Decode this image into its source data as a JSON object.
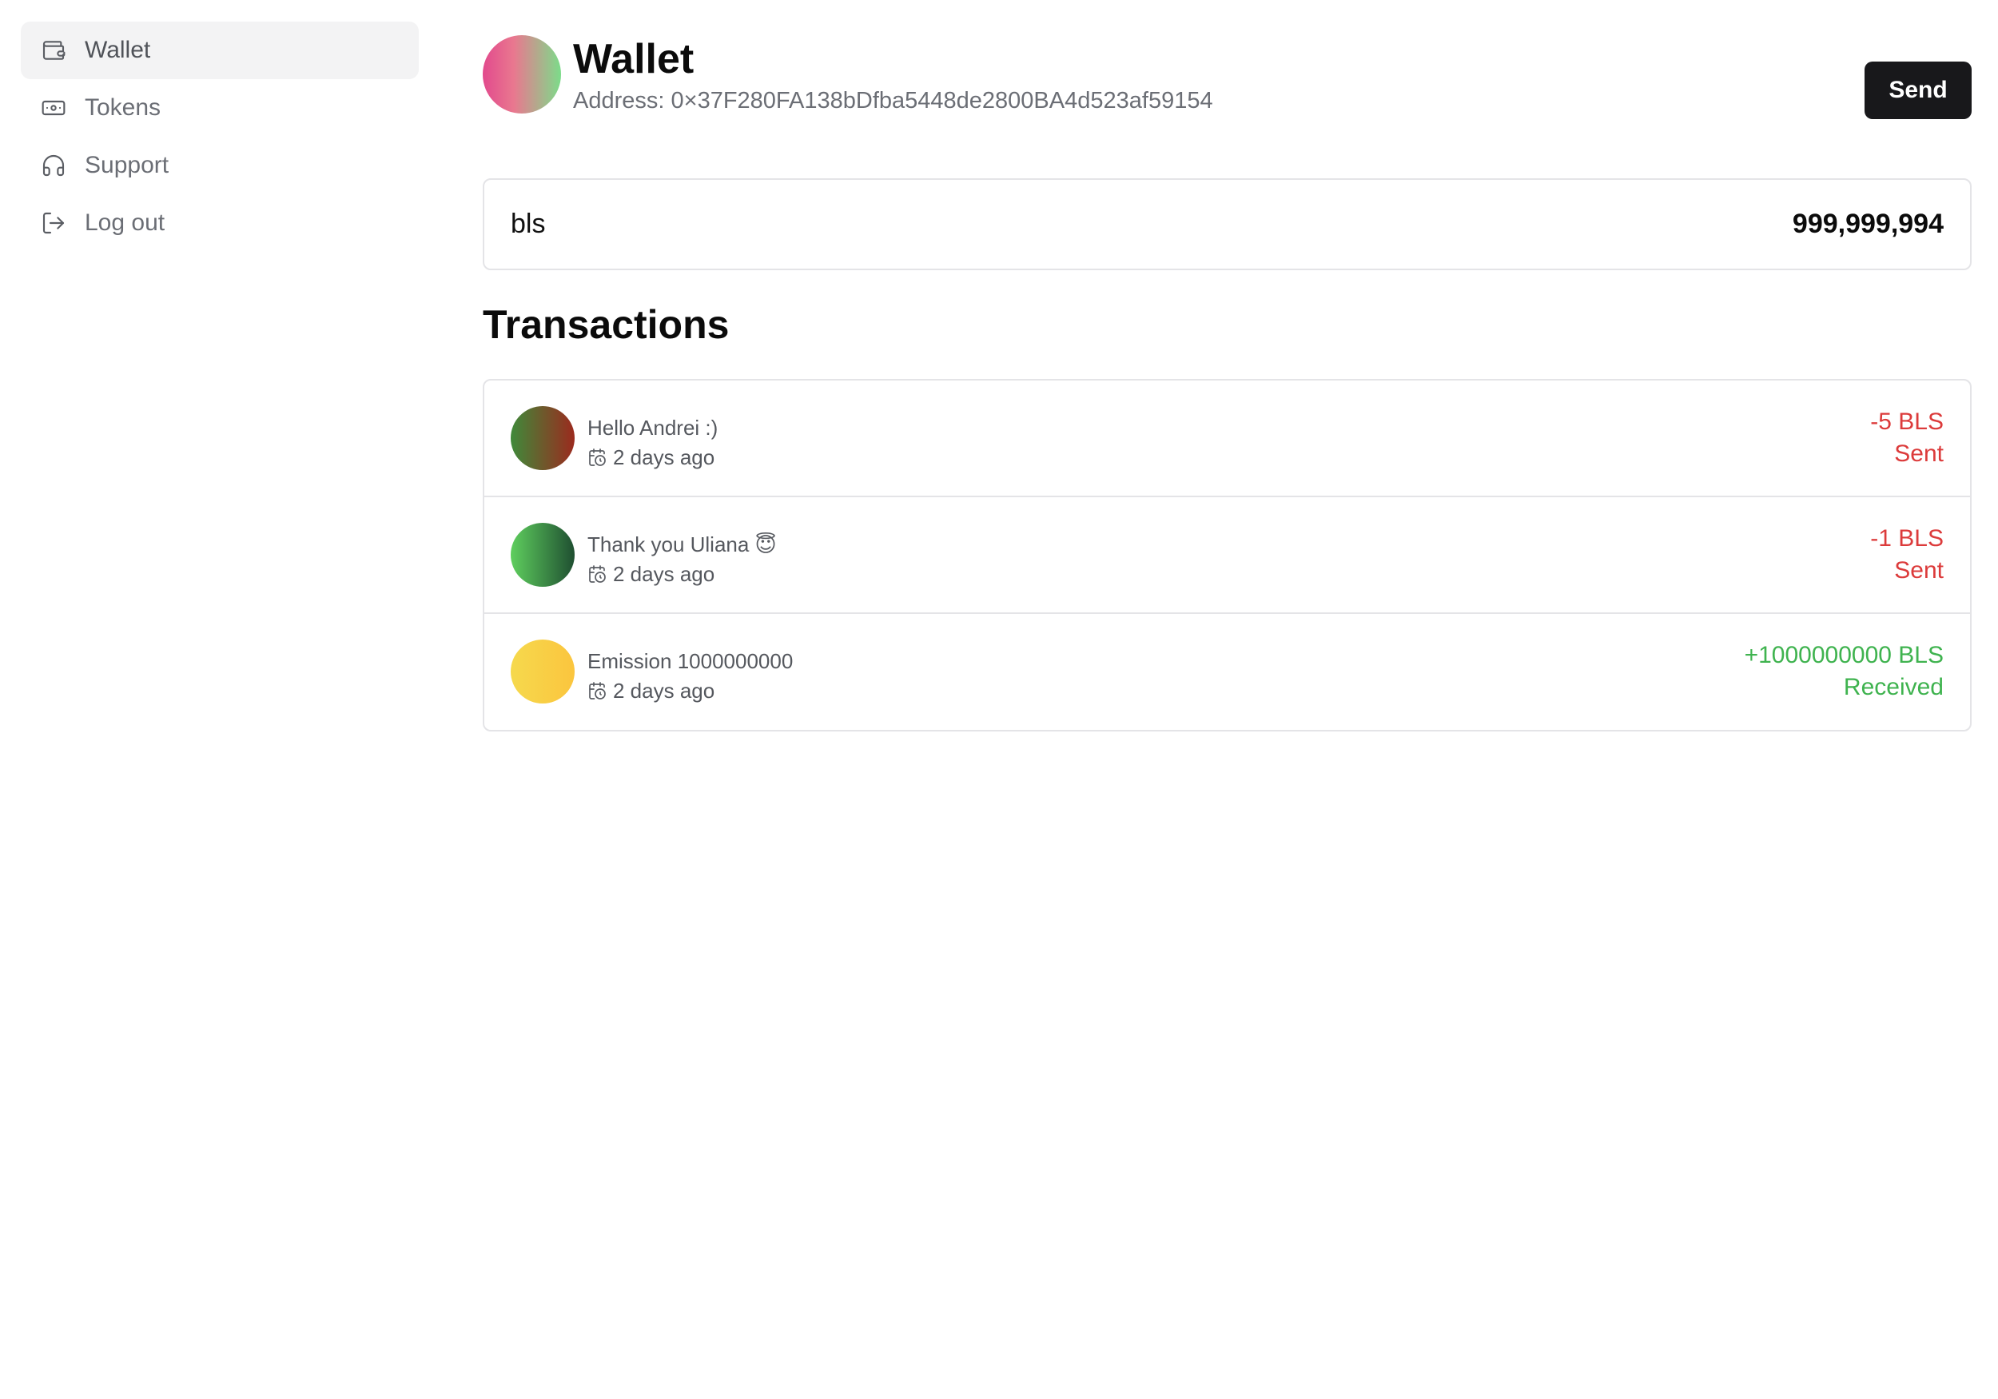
{
  "sidebar": {
    "items": [
      {
        "label": "Wallet",
        "icon": "wallet-icon",
        "active": true
      },
      {
        "label": "Tokens",
        "icon": "banknote-icon",
        "active": false
      },
      {
        "label": "Support",
        "icon": "headphones-icon",
        "active": false
      },
      {
        "label": "Log out",
        "icon": "logout-icon",
        "active": false
      }
    ]
  },
  "header": {
    "title": "Wallet",
    "address": "Address: 0×37F280FA138bDfba5448de2800BA4d523af59154",
    "send_label": "Send"
  },
  "balance": {
    "token": "bls",
    "amount": "999,999,994"
  },
  "transactions": {
    "title": "Transactions",
    "items": [
      {
        "title": "Hello Andrei :)",
        "date": "2 days ago",
        "amount": "-5 BLS",
        "status": "Sent",
        "type": "sent",
        "avatar_colors": [
          "#3f8a3a",
          "#9b2a1e"
        ]
      },
      {
        "title": "Thank you Uliana 😇",
        "date": "2 days ago",
        "amount": "-1 BLS",
        "status": "Sent",
        "type": "sent",
        "avatar_colors": [
          "#5fcf5e",
          "#1f4f31"
        ]
      },
      {
        "title": "Emission 1000000000",
        "date": "2 days ago",
        "amount": "+1000000000 BLS",
        "status": "Received",
        "type": "received",
        "avatar_colors": [
          "#f6d94d",
          "#fbc53e"
        ]
      }
    ]
  },
  "colors": {
    "send_button_bg": "#18181b",
    "sent": "#dc3b3b",
    "received": "#3fb34f",
    "active_nav_bg": "#f3f3f4"
  }
}
